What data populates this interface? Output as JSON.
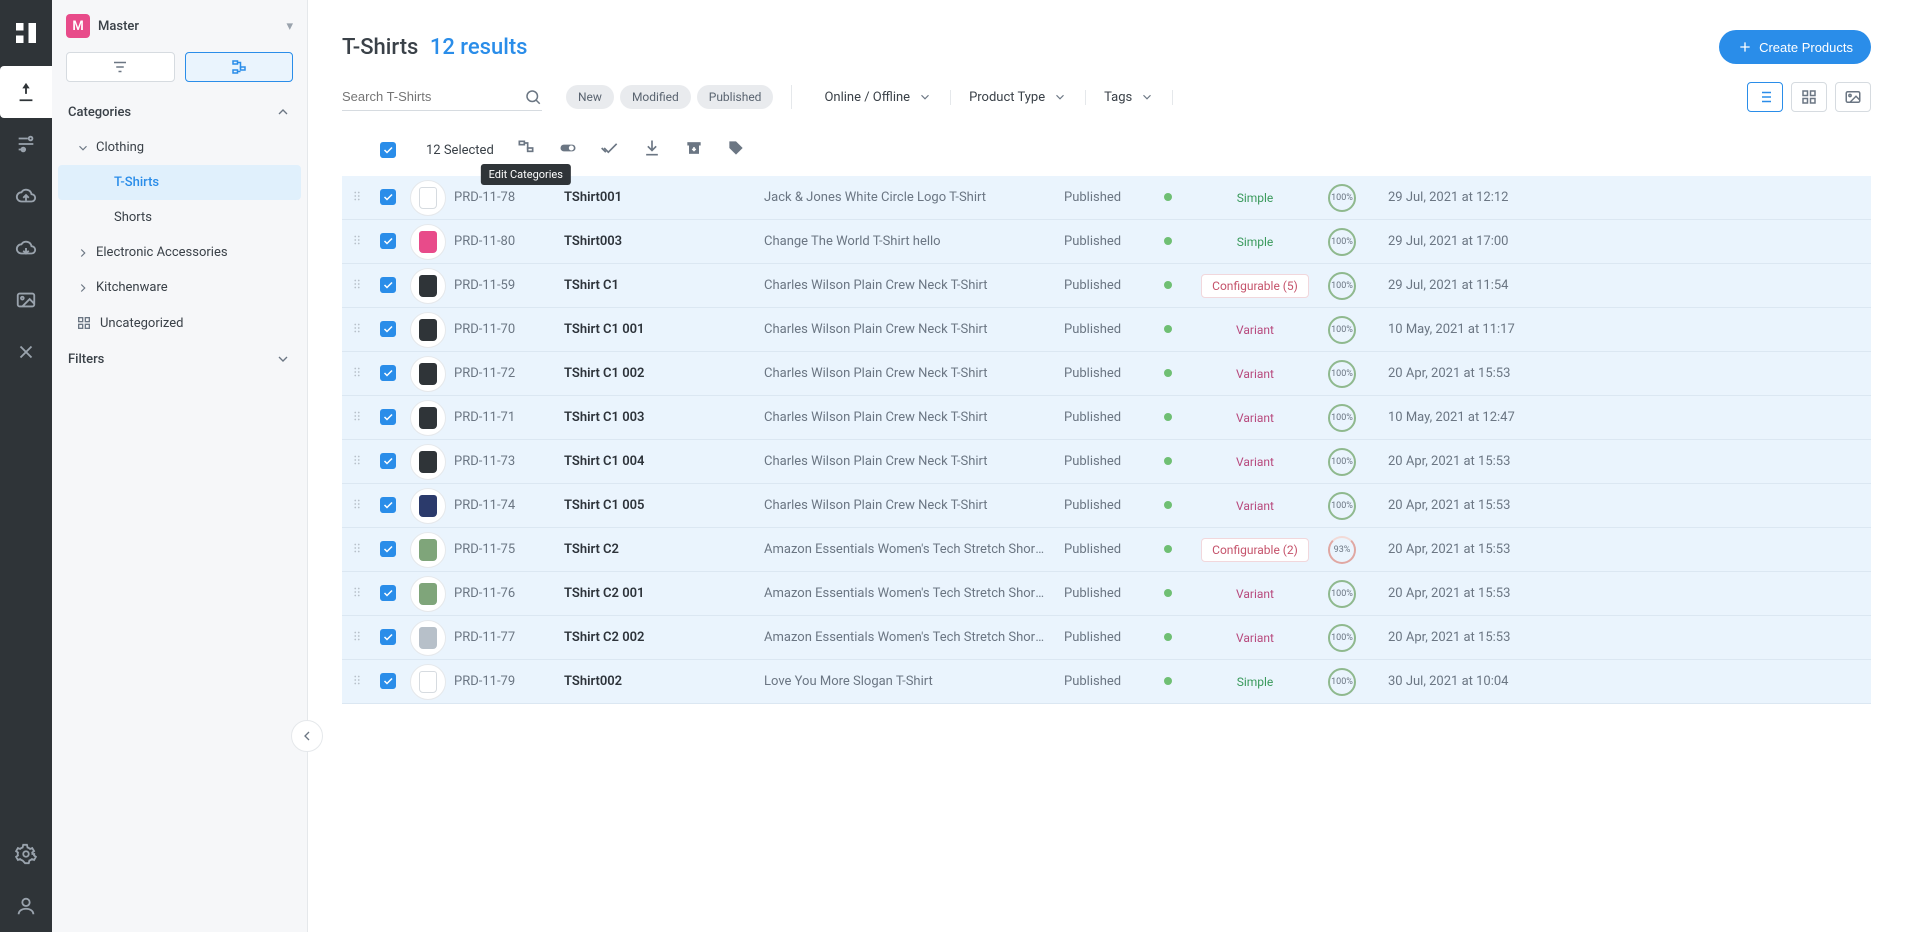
{
  "master": {
    "badge": "M",
    "label": "Master"
  },
  "sidebar": {
    "categories_header": "Categories",
    "filters_header": "Filters",
    "nodes": {
      "clothing": "Clothing",
      "tshirts": "T-Shirts",
      "shorts": "Shorts",
      "electronics": "Electronic Accessories",
      "kitchen": "Kitchenware",
      "uncat": "Uncategorized"
    }
  },
  "header": {
    "title": "T-Shirts",
    "results": "12 results",
    "create": "Create Products"
  },
  "search": {
    "placeholder": "Search T-Shirts"
  },
  "chips": {
    "new": "New",
    "modified": "Modified",
    "published": "Published"
  },
  "filters": {
    "online": "Online / Offline",
    "ptype": "Product Type",
    "tags": "Tags"
  },
  "bulk": {
    "selected": "12 Selected",
    "tooltip": "Edit Categories"
  },
  "type_labels": {
    "simple": "Simple",
    "variant": "Variant"
  },
  "rows": [
    {
      "sku": "PRD-11-78",
      "name": "TShirt001",
      "desc": "Jack & Jones White Circle Logo T-Shirt",
      "status": "Published",
      "type": "simple",
      "type_text": "Simple",
      "comp": "100%",
      "date": "29 Jul, 2021 at 12:12",
      "thumb": "#ffffff",
      "thumbBorder": "#d6dbe0"
    },
    {
      "sku": "PRD-11-80",
      "name": "TShirt003",
      "desc": "Change The World T-Shirt hello",
      "status": "Published",
      "type": "simple",
      "type_text": "Simple",
      "comp": "100%",
      "date": "29 Jul, 2021 at 17:00",
      "thumb": "#e84b8a"
    },
    {
      "sku": "PRD-11-59",
      "name": "TShirt C1",
      "desc": "Charles Wilson Plain Crew Neck T-Shirt",
      "status": "Published",
      "type": "config",
      "type_text": "Configurable (5)",
      "comp": "100%",
      "date": "29 Jul, 2021 at 11:54",
      "thumb": "#2f3438"
    },
    {
      "sku": "PRD-11-70",
      "name": "TShirt C1 001",
      "desc": "Charles Wilson Plain Crew Neck T-Shirt",
      "status": "Published",
      "type": "variant",
      "type_text": "Variant",
      "comp": "100%",
      "date": "10 May, 2021 at 11:17",
      "thumb": "#2f3438"
    },
    {
      "sku": "PRD-11-72",
      "name": "TShirt C1 002",
      "desc": "Charles Wilson Plain Crew Neck T-Shirt",
      "status": "Published",
      "type": "variant",
      "type_text": "Variant",
      "comp": "100%",
      "date": "20 Apr, 2021 at 15:53",
      "thumb": "#2f3438"
    },
    {
      "sku": "PRD-11-71",
      "name": "TShirt C1 003",
      "desc": "Charles Wilson Plain Crew Neck T-Shirt",
      "status": "Published",
      "type": "variant",
      "type_text": "Variant",
      "comp": "100%",
      "date": "10 May, 2021 at 12:47",
      "thumb": "#2f3438"
    },
    {
      "sku": "PRD-11-73",
      "name": "TShirt C1 004",
      "desc": "Charles Wilson Plain Crew Neck T-Shirt",
      "status": "Published",
      "type": "variant",
      "type_text": "Variant",
      "comp": "100%",
      "date": "20 Apr, 2021 at 15:53",
      "thumb": "#2f3438"
    },
    {
      "sku": "PRD-11-74",
      "name": "TShirt C1 005",
      "desc": "Charles Wilson Plain Crew Neck T-Shirt",
      "status": "Published",
      "type": "variant",
      "type_text": "Variant",
      "comp": "100%",
      "date": "20 Apr, 2021 at 15:53",
      "thumb": "#2b3a6b"
    },
    {
      "sku": "PRD-11-75",
      "name": "TShirt C2",
      "desc": "Amazon Essentials Women's Tech Stretch Short-Slee...",
      "status": "Published",
      "type": "config",
      "type_text": "Configurable (2)",
      "comp": "93%",
      "comp_dashed": true,
      "date": "20 Apr, 2021 at 15:53",
      "thumb": "#7fa57a"
    },
    {
      "sku": "PRD-11-76",
      "name": "TShirt C2 001",
      "desc": "Amazon Essentials Women's Tech Stretch Short-Slee...",
      "status": "Published",
      "type": "variant",
      "type_text": "Variant",
      "comp": "100%",
      "date": "20 Apr, 2021 at 15:53",
      "thumb": "#7fa57a"
    },
    {
      "sku": "PRD-11-77",
      "name": "TShirt C2 002",
      "desc": "Amazon Essentials Women's Tech Stretch Short-Slee...",
      "status": "Published",
      "type": "variant",
      "type_text": "Variant",
      "comp": "100%",
      "date": "20 Apr, 2021 at 15:53",
      "thumb": "#b7c0c9"
    },
    {
      "sku": "PRD-11-79",
      "name": "TShirt002",
      "desc": "Love You More Slogan T-Shirt",
      "status": "Published",
      "type": "simple",
      "type_text": "Simple",
      "comp": "100%",
      "date": "30 Jul, 2021 at 10:04",
      "thumb": "#ffffff",
      "thumbBorder": "#d6dbe0"
    }
  ]
}
